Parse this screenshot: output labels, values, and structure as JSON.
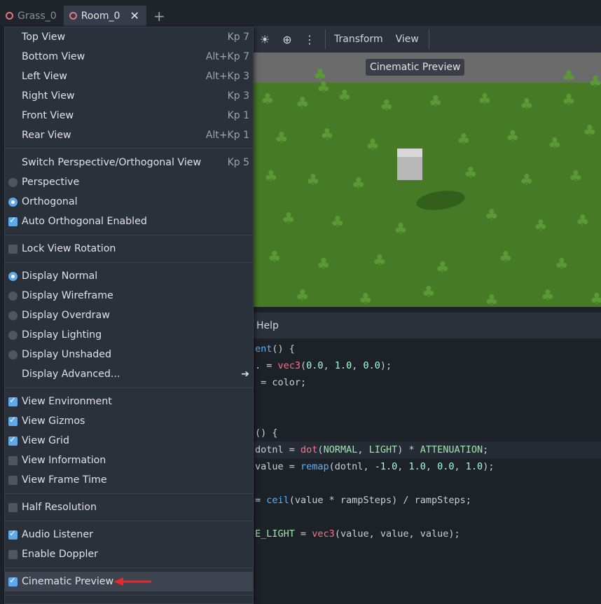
{
  "tabs": [
    {
      "label": "Grass_0",
      "active": false
    },
    {
      "label": "Room_0",
      "active": true
    }
  ],
  "toolbar": {
    "transform_label": "Transform",
    "view_label": "View",
    "icons": [
      "sun-icon",
      "globe-icon",
      "kebab-menu-icon"
    ]
  },
  "viewport": {
    "preview_label": "Cinematic Preview"
  },
  "code_header": {
    "help_label": "Help"
  },
  "code_lines": [
    {
      "text": "ent() {"
    },
    {
      "text": ". = vec3(0.0, 1.0, 0.0);"
    },
    {
      "text": " = color;"
    },
    {
      "text": ""
    },
    {
      "text": ""
    },
    {
      "text": "() {"
    },
    {
      "text": "dotnl = dot(NORMAL, LIGHT) * ATTENUATION;"
    },
    {
      "text": "value = remap(dotnl, -1.0, 1.0, 0.0, 1.0);"
    },
    {
      "text": ""
    },
    {
      "text": "= ceil(value * rampSteps) / rampSteps;"
    },
    {
      "text": ""
    },
    {
      "text": "E_LIGHT = vec3(value, value, value);"
    }
  ],
  "menu": {
    "items": [
      {
        "label": "Top View",
        "shortcut": "Kp 7"
      },
      {
        "label": "Bottom View",
        "shortcut": "Alt+Kp 7"
      },
      {
        "label": "Left View",
        "shortcut": "Alt+Kp 3"
      },
      {
        "label": "Right View",
        "shortcut": "Kp 3"
      },
      {
        "label": "Front View",
        "shortcut": "Kp 1"
      },
      {
        "label": "Rear View",
        "shortcut": "Alt+Kp 1"
      },
      {
        "label": "Switch Perspective/Orthogonal View",
        "shortcut": "Kp 5"
      },
      {
        "label": "Perspective",
        "radio": false
      },
      {
        "label": "Orthogonal",
        "radio": true
      },
      {
        "label": "Auto Orthogonal Enabled",
        "check": true
      },
      {
        "label": "Lock View Rotation",
        "check": false
      },
      {
        "label": "Display Normal",
        "radio": true
      },
      {
        "label": "Display Wireframe",
        "radio": false
      },
      {
        "label": "Display Overdraw",
        "radio": false
      },
      {
        "label": "Display Lighting",
        "radio": false
      },
      {
        "label": "Display Unshaded",
        "radio": false
      },
      {
        "label": "Display Advanced..."
      },
      {
        "label": "View Environment",
        "check": true
      },
      {
        "label": "View Gizmos",
        "check": true
      },
      {
        "label": "View Grid",
        "check": true
      },
      {
        "label": "View Information",
        "check": false
      },
      {
        "label": "View Frame Time",
        "check": false
      },
      {
        "label": "Half Resolution",
        "check": false
      },
      {
        "label": "Audio Listener",
        "check": true
      },
      {
        "label": "Enable Doppler",
        "check": false
      },
      {
        "label": "Cinematic Preview",
        "check": true
      }
    ]
  },
  "colors": {
    "accent": "#5fa8ea",
    "annotation_arrow": "#e8262b"
  }
}
